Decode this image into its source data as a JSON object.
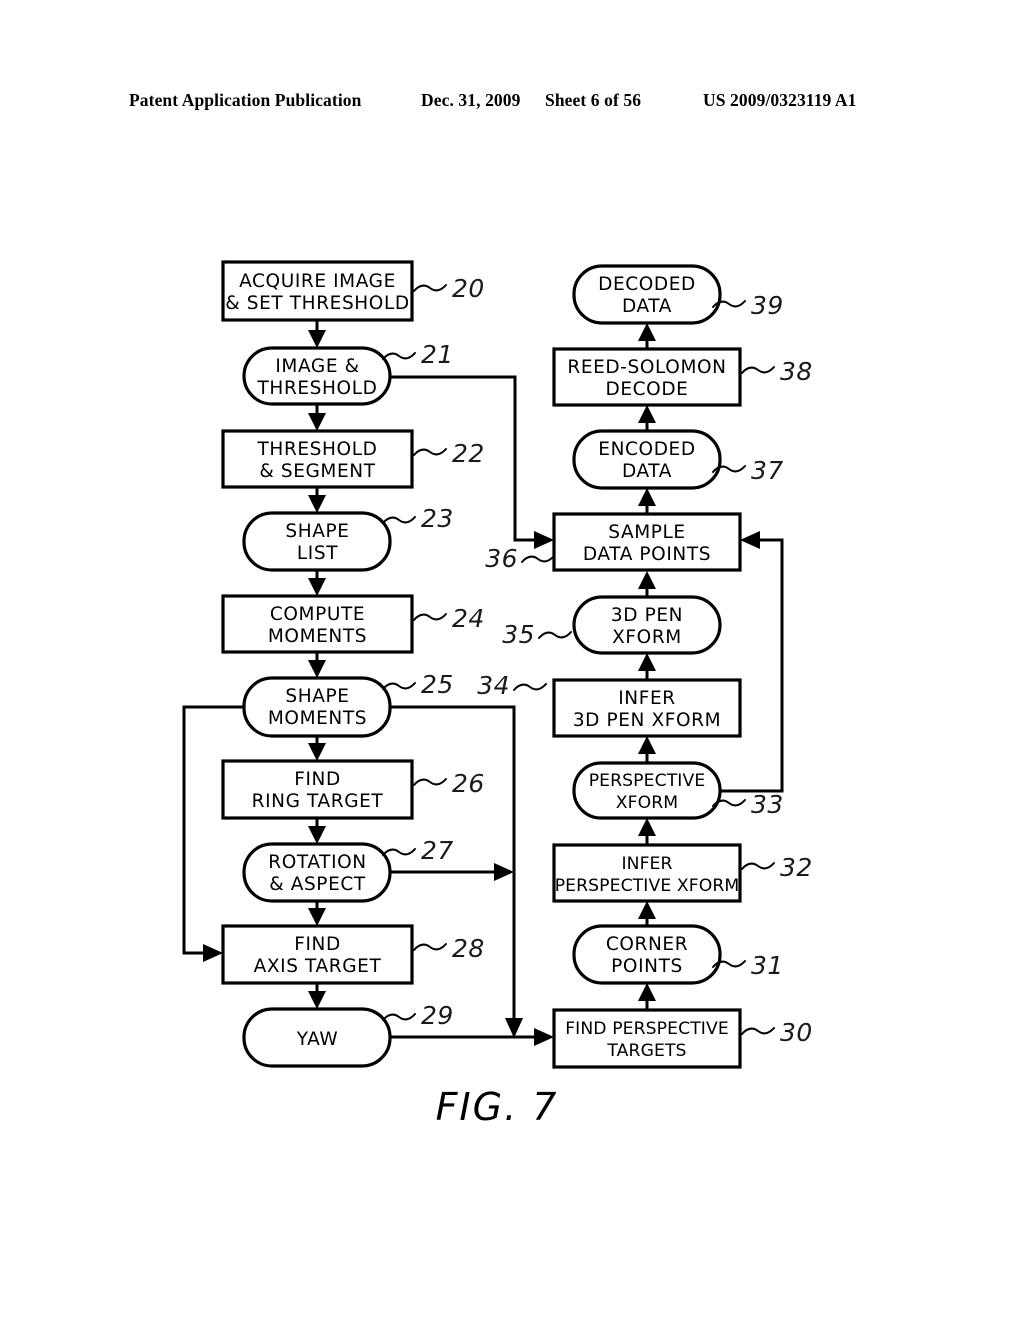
{
  "header": {
    "publication": "Patent Application Publication",
    "date": "Dec. 31, 2009",
    "sheet": "Sheet 6 of 56",
    "patent_number": "US 2009/0323119 A1"
  },
  "figure": {
    "caption": "FIG. 7",
    "type": "flowchart"
  },
  "nodes": [
    {
      "ref": "20",
      "label_lines": [
        "ACQUIRE IMAGE",
        "& SET THRESHOLD"
      ],
      "shape": "rect",
      "column": "left"
    },
    {
      "ref": "21",
      "label_lines": [
        "IMAGE &",
        "THRESHOLD"
      ],
      "shape": "stadium",
      "column": "left"
    },
    {
      "ref": "22",
      "label_lines": [
        "THRESHOLD",
        "& SEGMENT"
      ],
      "shape": "rect",
      "column": "left"
    },
    {
      "ref": "23",
      "label_lines": [
        "SHAPE",
        "LIST"
      ],
      "shape": "stadium",
      "column": "left"
    },
    {
      "ref": "24",
      "label_lines": [
        "COMPUTE",
        "MOMENTS"
      ],
      "shape": "rect",
      "column": "left"
    },
    {
      "ref": "25",
      "label_lines": [
        "SHAPE",
        "MOMENTS"
      ],
      "shape": "stadium",
      "column": "left"
    },
    {
      "ref": "26",
      "label_lines": [
        "FIND",
        "RING TARGET"
      ],
      "shape": "rect",
      "column": "left"
    },
    {
      "ref": "27",
      "label_lines": [
        "ROTATION",
        "& ASPECT"
      ],
      "shape": "stadium",
      "column": "left"
    },
    {
      "ref": "28",
      "label_lines": [
        "FIND",
        "AXIS TARGET"
      ],
      "shape": "rect",
      "column": "left"
    },
    {
      "ref": "29",
      "label_lines": [
        "YAW"
      ],
      "shape": "stadium",
      "column": "left"
    },
    {
      "ref": "30",
      "label_lines": [
        "FIND PERSPECTIVE",
        "TARGETS"
      ],
      "shape": "rect",
      "column": "right"
    },
    {
      "ref": "31",
      "label_lines": [
        "CORNER",
        "POINTS"
      ],
      "shape": "stadium",
      "column": "right"
    },
    {
      "ref": "32",
      "label_lines": [
        "INFER",
        "PERSPECTIVE XFORM"
      ],
      "shape": "rect",
      "column": "right"
    },
    {
      "ref": "33",
      "label_lines": [
        "PERSPECTIVE",
        "XFORM"
      ],
      "shape": "stadium",
      "column": "right"
    },
    {
      "ref": "34",
      "label_lines": [
        "INFER",
        "3D PEN XFORM"
      ],
      "shape": "rect",
      "column": "right"
    },
    {
      "ref": "35",
      "label_lines": [
        "3D PEN",
        "XFORM"
      ],
      "shape": "stadium",
      "column": "right"
    },
    {
      "ref": "36",
      "label_lines": [
        "SAMPLE",
        "DATA POINTS"
      ],
      "shape": "rect",
      "column": "right"
    },
    {
      "ref": "37",
      "label_lines": [
        "ENCODED",
        "DATA"
      ],
      "shape": "stadium",
      "column": "right"
    },
    {
      "ref": "38",
      "label_lines": [
        "REED-SOLOMON",
        "DECODE"
      ],
      "shape": "rect",
      "column": "right"
    },
    {
      "ref": "39",
      "label_lines": [
        "DECODED",
        "DATA"
      ],
      "shape": "stadium",
      "column": "right"
    }
  ],
  "edges": [
    {
      "from": "20",
      "to": "21"
    },
    {
      "from": "21",
      "to": "22"
    },
    {
      "from": "22",
      "to": "23"
    },
    {
      "from": "23",
      "to": "24"
    },
    {
      "from": "24",
      "to": "25"
    },
    {
      "from": "25",
      "to": "26"
    },
    {
      "from": "26",
      "to": "27"
    },
    {
      "from": "27",
      "to": "28"
    },
    {
      "from": "28",
      "to": "29"
    },
    {
      "from": "21",
      "to": "36"
    },
    {
      "from": "25",
      "to": "28"
    },
    {
      "from": "25",
      "to": "30"
    },
    {
      "from": "27",
      "to": "30"
    },
    {
      "from": "29",
      "to": "30"
    },
    {
      "from": "30",
      "to": "31"
    },
    {
      "from": "31",
      "to": "32"
    },
    {
      "from": "32",
      "to": "33"
    },
    {
      "from": "33",
      "to": "34"
    },
    {
      "from": "34",
      "to": "35"
    },
    {
      "from": "35",
      "to": "36"
    },
    {
      "from": "33",
      "to": "36"
    },
    {
      "from": "36",
      "to": "37"
    },
    {
      "from": "37",
      "to": "38"
    },
    {
      "from": "38",
      "to": "39"
    }
  ]
}
